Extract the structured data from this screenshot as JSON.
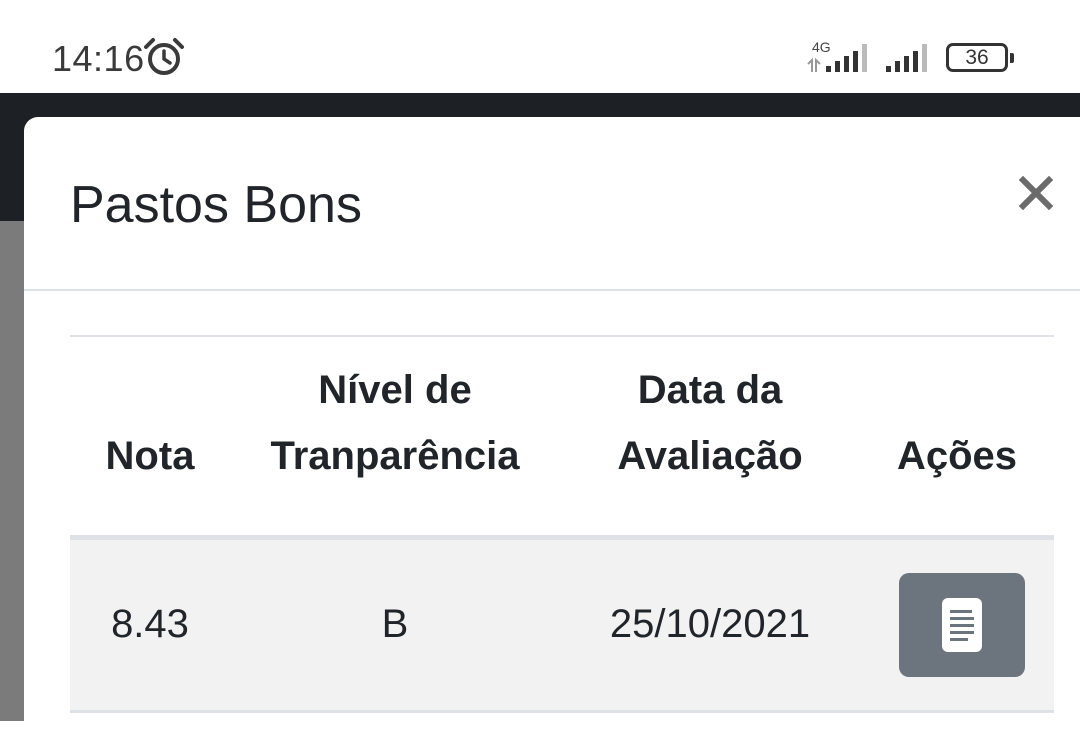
{
  "status_bar": {
    "time": "14:16",
    "network": "4G",
    "battery": "36"
  },
  "modal": {
    "title": "Pastos Bons",
    "close_label": "×"
  },
  "table": {
    "headers": {
      "nota": "Nota",
      "nivel_line1": "Nível de",
      "nivel_line2": "Tranparência",
      "data_line1": "Data da",
      "data_line2": "Avaliação",
      "acoes": "Ações"
    },
    "rows": [
      {
        "nota": "8.43",
        "nivel": "B",
        "data": "25/10/2021",
        "action_icon": "document-icon"
      }
    ]
  },
  "colors": {
    "action_button": "#6c757d",
    "row_background": "#f2f2f2",
    "app_header": "#1d2024",
    "backdrop": "#7b7b7b"
  }
}
